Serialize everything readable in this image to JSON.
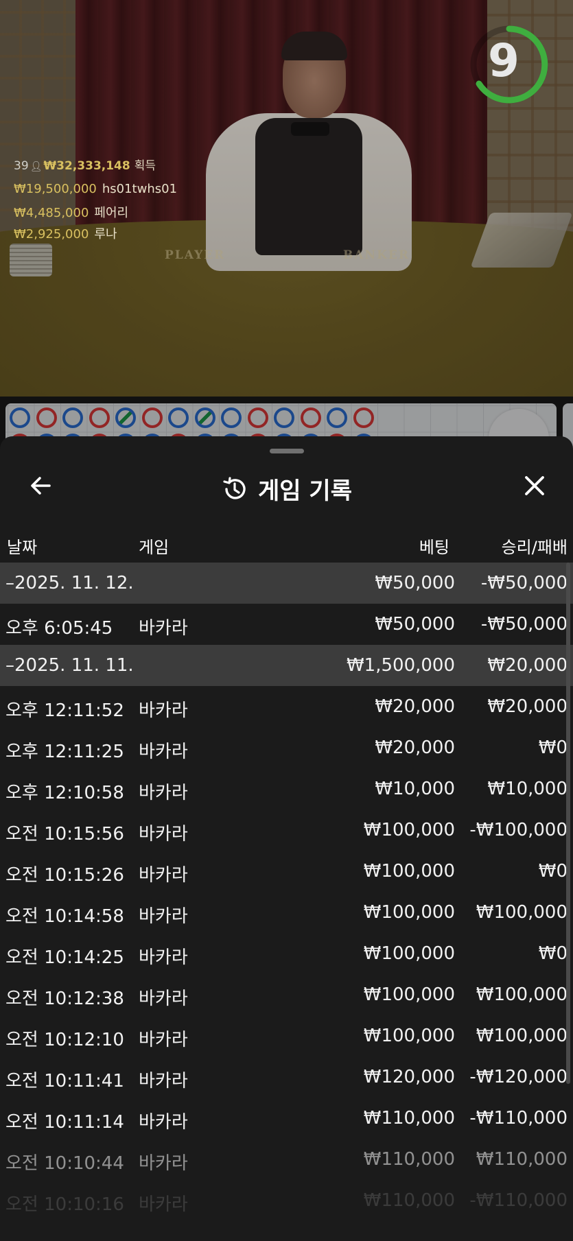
{
  "stream": {
    "timer": "9",
    "players_count": "39",
    "total_won": "₩32,333,148",
    "won_label": "획득",
    "winners": [
      {
        "amount": "₩19,500,000",
        "name": "hs01twhs01"
      },
      {
        "amount": "₩4,485,000",
        "name": "페어리"
      },
      {
        "amount": "₩2,925,000",
        "name": "루나"
      }
    ],
    "table_labels": {
      "player": "PLAYER",
      "banker": "BANKER"
    }
  },
  "road": {
    "top_row": [
      "P",
      "B",
      "P",
      "B",
      "T",
      "B",
      "P",
      "T",
      "P",
      "B",
      "P",
      "B",
      "P",
      "B"
    ],
    "colors": {
      "player": "#2a6fd6",
      "banker": "#e03a3a",
      "tie": "#1e9c4a"
    }
  },
  "sheet": {
    "title": "게임 기록",
    "icons": {
      "back": "arrow-left-icon",
      "history": "history-icon",
      "close": "close-icon"
    },
    "columns": {
      "date": "날짜",
      "game": "게임",
      "bet": "베팅",
      "result": "승리/패배"
    },
    "rows": [
      {
        "type": "group",
        "date": "–2025. 11. 12.",
        "game": "",
        "bet": "₩50,000",
        "result": "-₩50,000"
      },
      {
        "type": "item",
        "date": "오후 6:05:45",
        "game": "바카라",
        "bet": "₩50,000",
        "result": "-₩50,000"
      },
      {
        "type": "group",
        "date": "–2025. 11. 11.",
        "game": "",
        "bet": "₩1,500,000",
        "result": "₩20,000"
      },
      {
        "type": "item",
        "date": "오후 12:11:52",
        "game": "바카라",
        "bet": "₩20,000",
        "result": "₩20,000"
      },
      {
        "type": "item",
        "date": "오후 12:11:25",
        "game": "바카라",
        "bet": "₩20,000",
        "result": "₩0"
      },
      {
        "type": "item",
        "date": "오후 12:10:58",
        "game": "바카라",
        "bet": "₩10,000",
        "result": "₩10,000"
      },
      {
        "type": "item",
        "date": "오전 10:15:56",
        "game": "바카라",
        "bet": "₩100,000",
        "result": "-₩100,000"
      },
      {
        "type": "item",
        "date": "오전 10:15:26",
        "game": "바카라",
        "bet": "₩100,000",
        "result": "₩0"
      },
      {
        "type": "item",
        "date": "오전 10:14:58",
        "game": "바카라",
        "bet": "₩100,000",
        "result": "₩100,000"
      },
      {
        "type": "item",
        "date": "오전 10:14:25",
        "game": "바카라",
        "bet": "₩100,000",
        "result": "₩0"
      },
      {
        "type": "item",
        "date": "오전 10:12:38",
        "game": "바카라",
        "bet": "₩100,000",
        "result": "₩100,000"
      },
      {
        "type": "item",
        "date": "오전 10:12:10",
        "game": "바카라",
        "bet": "₩100,000",
        "result": "₩100,000"
      },
      {
        "type": "item",
        "date": "오전 10:11:41",
        "game": "바카라",
        "bet": "₩120,000",
        "result": "-₩120,000"
      },
      {
        "type": "item",
        "date": "오전 10:11:14",
        "game": "바카라",
        "bet": "₩110,000",
        "result": "-₩110,000"
      },
      {
        "type": "item",
        "date": "오전 10:10:44",
        "game": "바카라",
        "bet": "₩110,000",
        "result": "₩110,000"
      },
      {
        "type": "item",
        "date": "오전 10:10:16",
        "game": "바카라",
        "bet": "₩110,000",
        "result": "-₩110,000"
      }
    ]
  }
}
